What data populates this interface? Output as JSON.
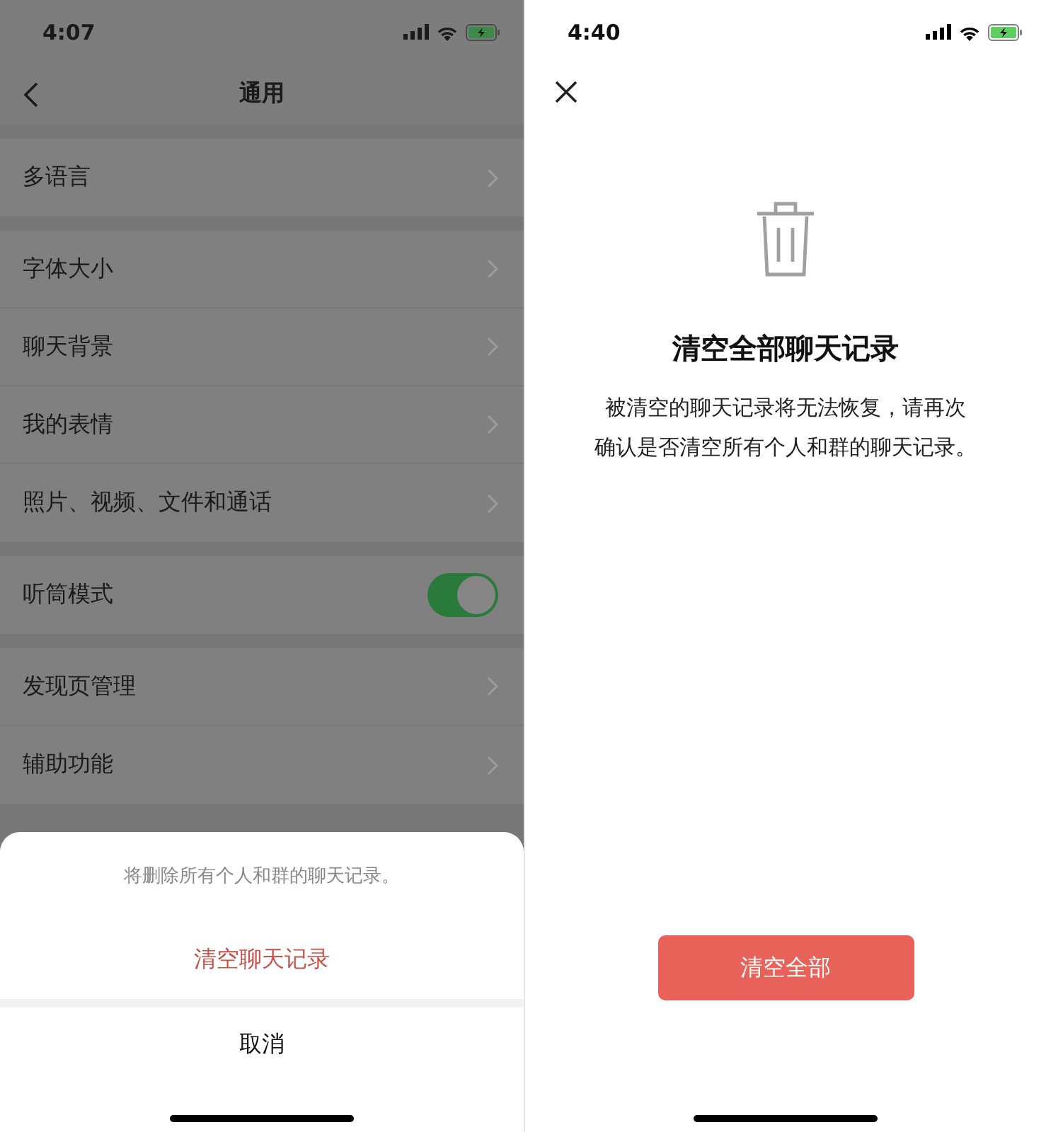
{
  "left_screen": {
    "status_bar": {
      "time": "4:07"
    },
    "nav_bar": {
      "title": "通用"
    },
    "settings_groups": [
      [
        {
          "kind": "link",
          "label": "多语言"
        }
      ],
      [
        {
          "kind": "link",
          "label": "字体大小"
        },
        {
          "kind": "link",
          "label": "聊天背景"
        },
        {
          "kind": "link",
          "label": "我的表情"
        },
        {
          "kind": "link",
          "label": "照片、视频、文件和通话"
        }
      ],
      [
        {
          "kind": "switch",
          "label": "听筒模式",
          "on": true
        }
      ],
      [
        {
          "kind": "link",
          "label": "发现页管理"
        },
        {
          "kind": "link",
          "label": "辅助功能"
        }
      ]
    ],
    "action_sheet": {
      "message": "将删除所有个人和群的聊天记录。",
      "action": "清空聊天记录",
      "cancel": "取消"
    }
  },
  "right_screen": {
    "status_bar": {
      "time": "4:40"
    },
    "title": "清空全部聊天记录",
    "description_lines": [
      "被清空的聊天记录将无法恢复，请再次",
      "确认是否清空所有个人和群的聊天记录。"
    ],
    "button": "清空全部"
  }
}
